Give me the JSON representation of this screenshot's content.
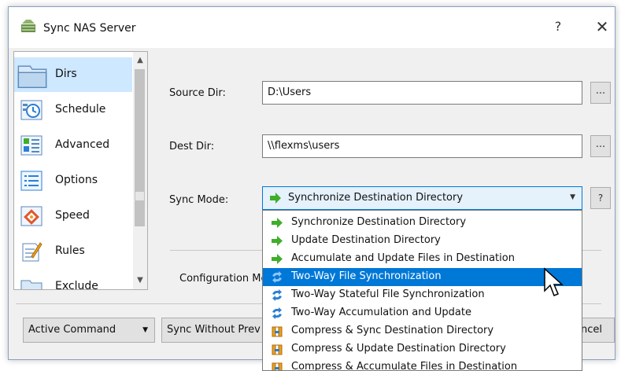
{
  "window": {
    "title": "Sync NAS Server",
    "help_glyph": "?",
    "close_glyph": "✕"
  },
  "nav": {
    "items": [
      {
        "label": "Dirs",
        "icon": "folder-icon",
        "selected": true
      },
      {
        "label": "Schedule",
        "icon": "schedule-icon",
        "selected": false
      },
      {
        "label": "Advanced",
        "icon": "advanced-icon",
        "selected": false
      },
      {
        "label": "Options",
        "icon": "options-list-icon",
        "selected": false
      },
      {
        "label": "Speed",
        "icon": "speed-icon",
        "selected": false
      },
      {
        "label": "Rules",
        "icon": "rules-icon",
        "selected": false
      },
      {
        "label": "Exclude",
        "icon": "exclude-folder-icon",
        "selected": false
      }
    ],
    "scroll_up": "▲",
    "scroll_down": "▼"
  },
  "form": {
    "source_label": "Source Dir:",
    "source_value": "D:\\Users",
    "dest_label": "Dest Dir:",
    "dest_value": "\\\\flexms\\users",
    "browse_label": "...",
    "sync_mode_label": "Sync Mode:",
    "sync_mode_value": "Synchronize Destination Directory",
    "sync_mode_help": "?",
    "config_label": "Configuration Mo"
  },
  "dropdown": {
    "options": [
      {
        "label": "Synchronize Destination Directory",
        "icon": "green-arrow-icon",
        "highlighted": false
      },
      {
        "label": "Update Destination Directory",
        "icon": "green-arrow-icon",
        "highlighted": false
      },
      {
        "label": "Accumulate and Update Files in Destination",
        "icon": "green-arrow-icon",
        "highlighted": false
      },
      {
        "label": "Two-Way File Synchronization",
        "icon": "two-way-sync-icon",
        "highlighted": true
      },
      {
        "label": "Two-Way Stateful File Synchronization",
        "icon": "two-way-sync-icon",
        "highlighted": false
      },
      {
        "label": "Two-Way Accumulation and Update",
        "icon": "two-way-sync-icon",
        "highlighted": false
      },
      {
        "label": "Compress & Sync Destination Directory",
        "icon": "compress-icon",
        "highlighted": false
      },
      {
        "label": "Compress & Update Destination Directory",
        "icon": "compress-icon",
        "highlighted": false
      },
      {
        "label": "Compress & Accumulate Files in Destination",
        "icon": "compress-icon",
        "highlighted": false
      }
    ]
  },
  "footer": {
    "active_command": "Active Command",
    "sync_without_preview": "Sync Without Prev",
    "cancel": "ncel",
    "caret": "▼"
  },
  "colors": {
    "selection": "#cde8ff",
    "highlight": "#0078d7",
    "accent_green": "#3fae2a",
    "sync_blue": "#2a7fd4",
    "compress_orange": "#e8a11a"
  }
}
